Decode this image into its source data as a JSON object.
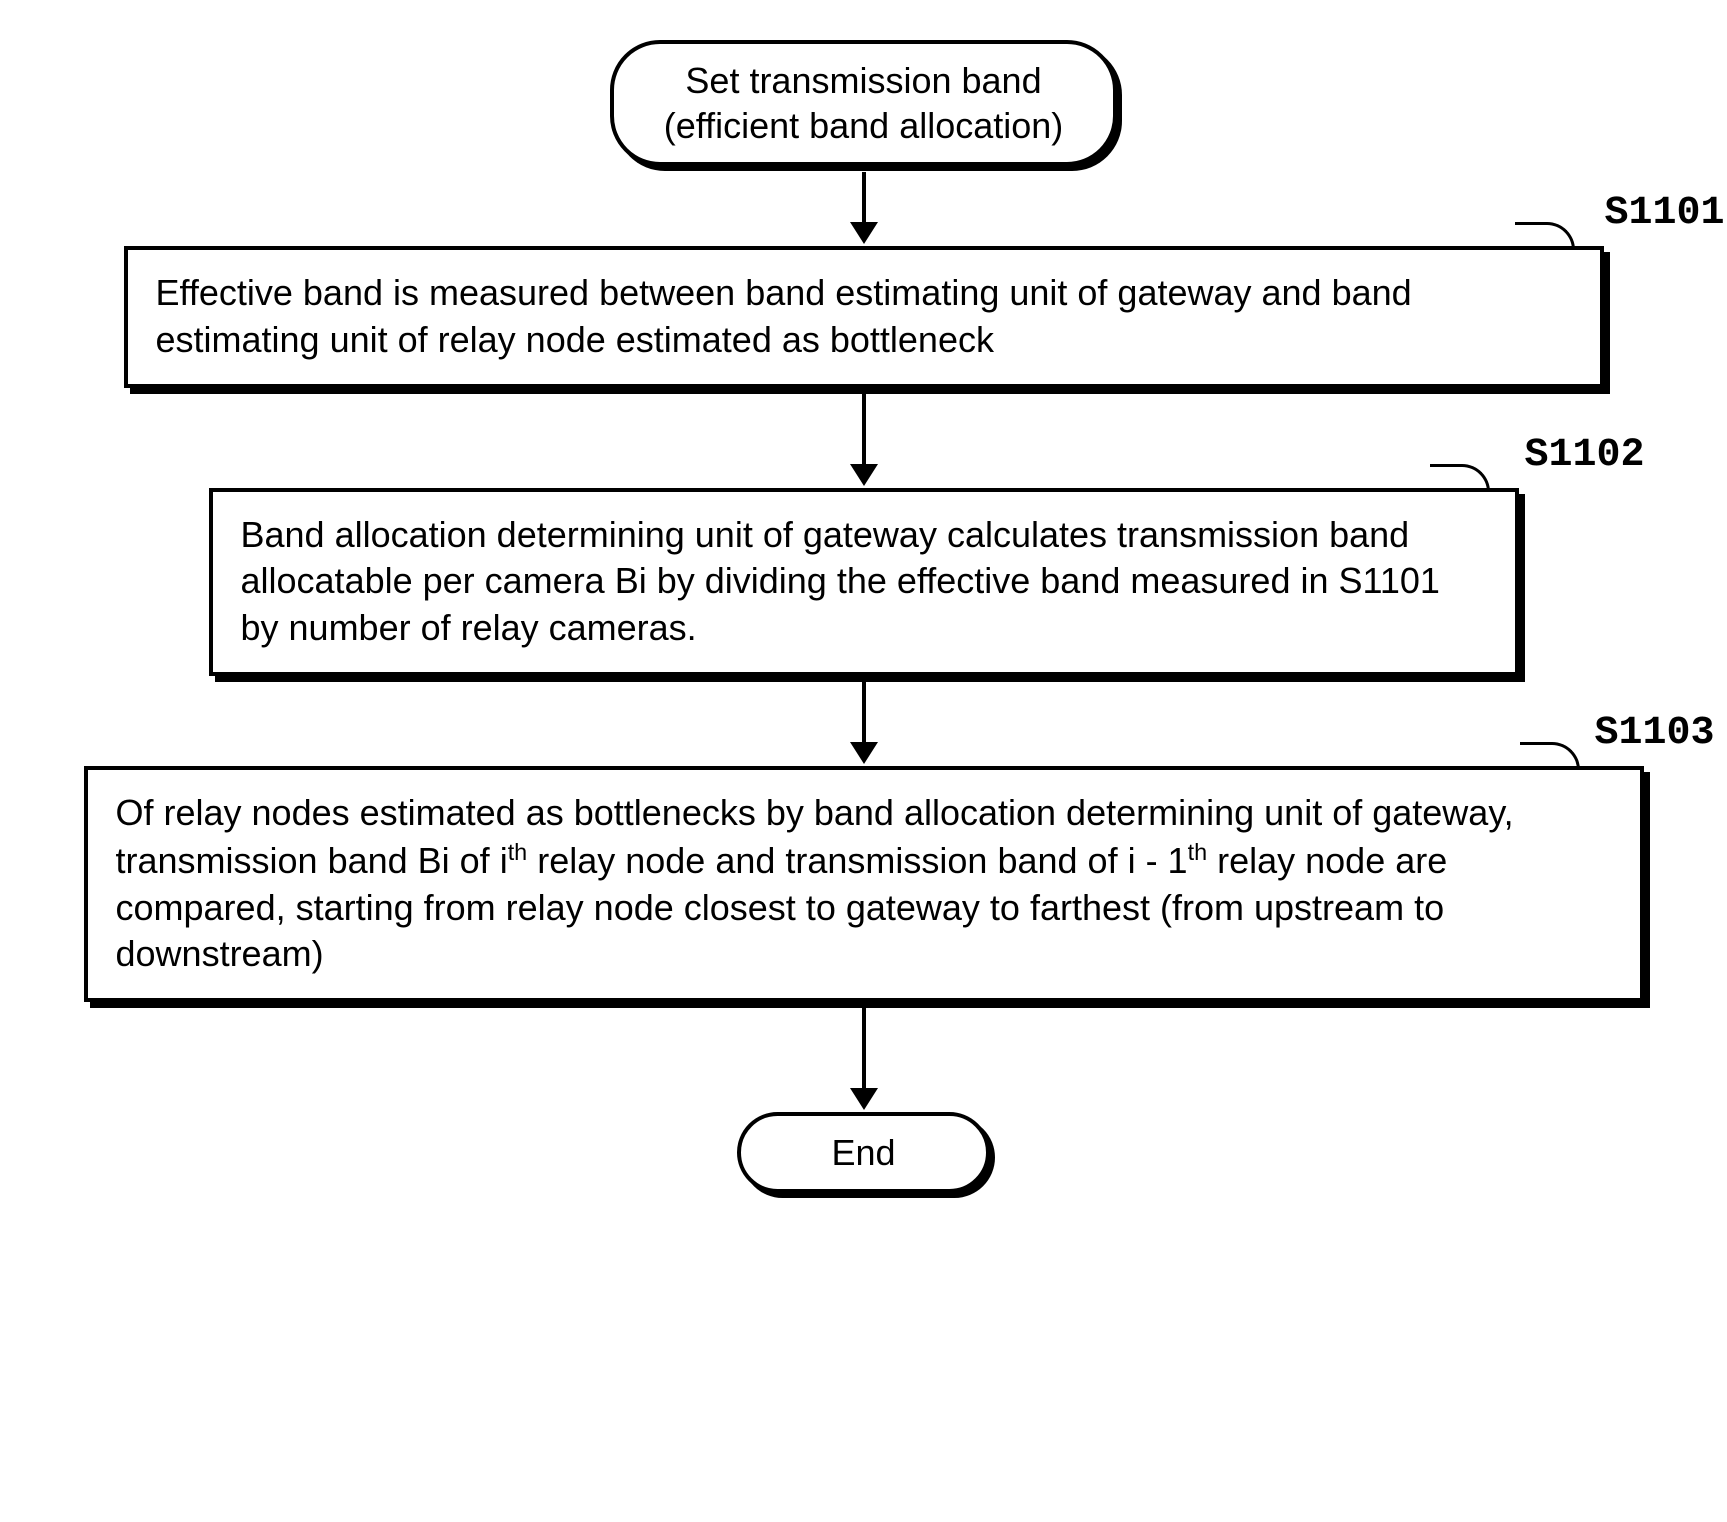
{
  "chart_data": {
    "type": "flowchart",
    "nodes": [
      {
        "id": "start",
        "shape": "terminal",
        "lines": [
          "Set transmission band",
          "(efficient band allocation)"
        ]
      },
      {
        "id": "S1101",
        "shape": "process",
        "label": "S1101",
        "text": "Effective band is measured between band estimating unit of gateway and band estimating unit of relay node estimated as bottleneck"
      },
      {
        "id": "S1102",
        "shape": "process",
        "label": "S1102",
        "text": "Band allocation determining unit of gateway calculates transmission band allocatable per camera Bi by dividing the effective band measured in S1101 by number of relay cameras."
      },
      {
        "id": "S1103",
        "shape": "process",
        "label": "S1103",
        "text_html": "Of relay nodes estimated as bottlenecks by band allocation determining unit of gateway, transmission band Bi of i<sup>th</sup> relay node and transmission band of i - 1<sup>th</sup> relay node are compared, starting from relay node closest to gateway to farthest (from upstream to downstream)"
      },
      {
        "id": "end",
        "shape": "terminal",
        "text": "End"
      }
    ],
    "edges": [
      {
        "from": "start",
        "to": "S1101"
      },
      {
        "from": "S1101",
        "to": "S1102"
      },
      {
        "from": "S1102",
        "to": "S1103"
      },
      {
        "from": "S1103",
        "to": "end"
      }
    ]
  },
  "start": {
    "line1": "Set transmission band",
    "line2": "(efficient band allocation)"
  },
  "step1": {
    "label": "S1101",
    "text": "Effective band is measured between band estimating unit of gateway and band estimating unit of relay node estimated as bottleneck"
  },
  "step2": {
    "label": "S1102",
    "text": "Band allocation determining unit of gateway calculates transmission band allocatable per camera Bi by dividing the effective band measured in S1101 by number of relay cameras."
  },
  "step3": {
    "label": "S1103",
    "text_html": "Of relay nodes estimated as bottlenecks by band allocation determining unit of gateway, transmission band Bi of i<sup>th</sup> relay node and transmission band of i - 1<sup>th</sup> relay node are compared, starting from relay node closest to gateway to farthest (from upstream to downstream)"
  },
  "end": {
    "text": "End"
  }
}
